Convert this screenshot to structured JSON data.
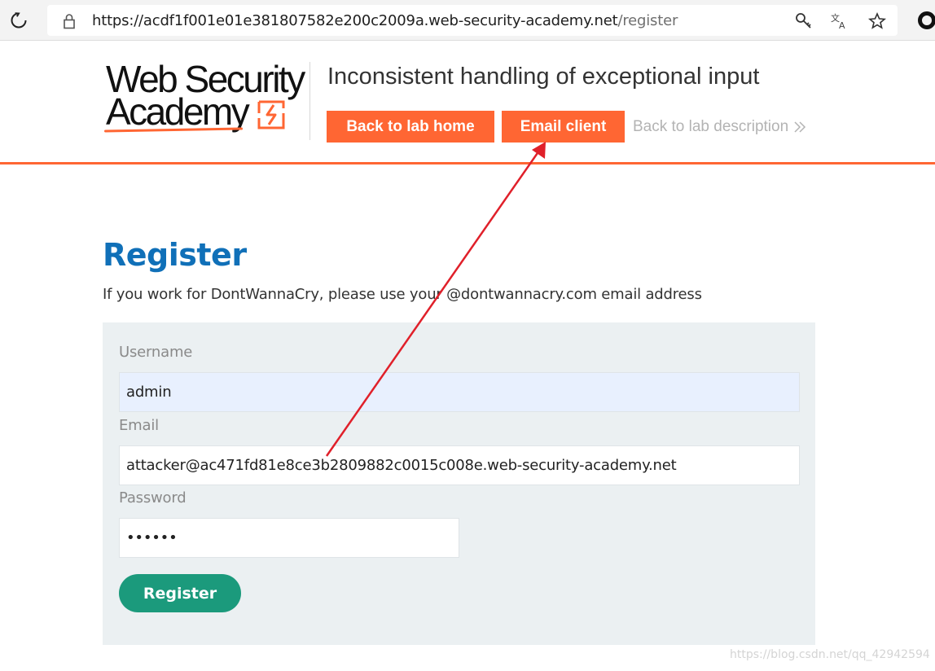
{
  "browser": {
    "url_host": "https://acdf1f001e01e381807582e200c2009a.web-security-academy.net",
    "url_path": "/register",
    "icons": [
      "reload-icon",
      "lock-icon",
      "key-icon",
      "translate-icon",
      "star-icon",
      "profile-icon"
    ]
  },
  "header": {
    "logo_line1": "Web Security",
    "logo_line2": "Academy",
    "lab_title": "Inconsistent handling of exceptional input",
    "back_to_lab_home": "Back to lab home",
    "email_client": "Email client",
    "back_to_lab_description": "Back to lab description",
    "accent_color": "#ff6633"
  },
  "main": {
    "title": "Register",
    "notice": "If you work for DontWannaCry, please use your @dontwannacry.com email address",
    "form": {
      "username_label": "Username",
      "username_value": "admin",
      "email_label": "Email",
      "email_value": "attacker@ac471fd81e8ce3b2809882c0015c008e.web-security-academy.net",
      "password_label": "Password",
      "password_value": "••••••",
      "submit_label": "Register"
    },
    "title_color": "#1070b8",
    "button_color": "#1b9a7c"
  },
  "annotation": {
    "arrow_color": "#e0202a"
  },
  "watermark": "https://blog.csdn.net/qq_42942594"
}
